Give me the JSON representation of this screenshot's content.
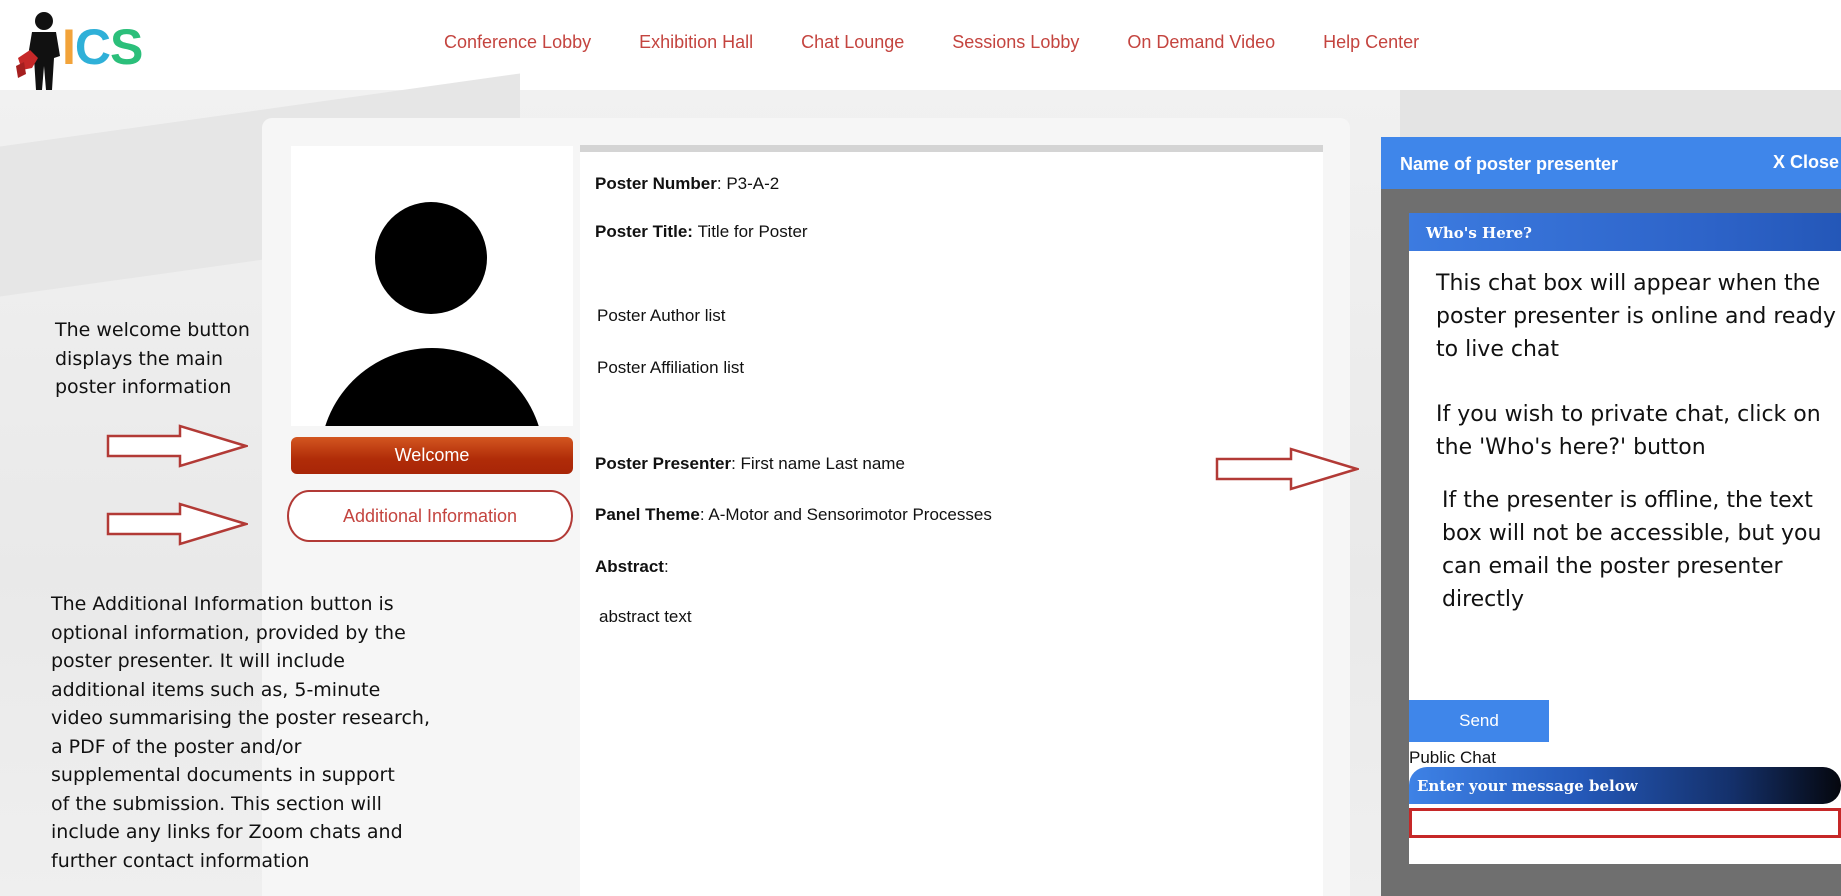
{
  "logo": {
    "letters": [
      "I",
      "C",
      "S"
    ]
  },
  "nav": {
    "items": [
      {
        "label": "Conference Lobby"
      },
      {
        "label": "Exhibition Hall"
      },
      {
        "label": "Chat Lounge"
      },
      {
        "label": "Sessions Lobby"
      },
      {
        "label": "On Demand Video"
      },
      {
        "label": "Help Center"
      }
    ]
  },
  "profile": {
    "welcome_label": "Welcome",
    "additional_info_label": "Additional Information"
  },
  "poster": {
    "number_label": "Poster Number",
    "number_value": ": P3-A-2",
    "title_label": "Poster Title:",
    "title_value": "Title for Poster",
    "author_list": "Poster Author list",
    "affiliation_list": "Poster Affiliation list",
    "presenter_label": "Poster Presenter",
    "presenter_value": ":   First name Last name",
    "panel_theme_label": "Panel Theme",
    "panel_theme_value": ": A-Motor and Sensorimotor Processes",
    "abstract_label": "Abstract",
    "abstract_colon": ":",
    "abstract_text": "abstract text"
  },
  "annotations": {
    "welcome_note": [
      "The welcome button",
      "displays the main",
      "poster information"
    ],
    "additional_note": [
      "The Additional Information button is",
      "optional information, provided by the",
      "poster presenter. It will include",
      "additional items such as, 5-minute",
      "video summarising the poster research,",
      "a PDF of the poster and/or",
      "supplemental  documents in support",
      "of the submission. This section will",
      "include any links for Zoom chats and",
      "further contact information"
    ]
  },
  "chat": {
    "header_title": "Name of poster presenter",
    "close_label": "X Close",
    "who_here_label": "Who's Here?",
    "note_online": [
      "This chat box will appear when the",
      "poster presenter is online and ready",
      "to live chat"
    ],
    "note_private": [
      "If you wish to private chat, click on",
      "the 'Who's here?' button"
    ],
    "note_offline": [
      "If the presenter is offline, the text",
      "box will not be accessible, but you",
      "can email the poster presenter",
      "directly"
    ],
    "message_prompt": "Enter your message below",
    "message_value": "",
    "send_label": "Send",
    "public_chat_label": "Public Chat"
  },
  "colors": {
    "nav_link": "#c4443f",
    "welcome_button": "#b02c08",
    "chat_header": "#3f86ea",
    "arrow_outline": "#b23a36",
    "input_border": "#c62828"
  }
}
